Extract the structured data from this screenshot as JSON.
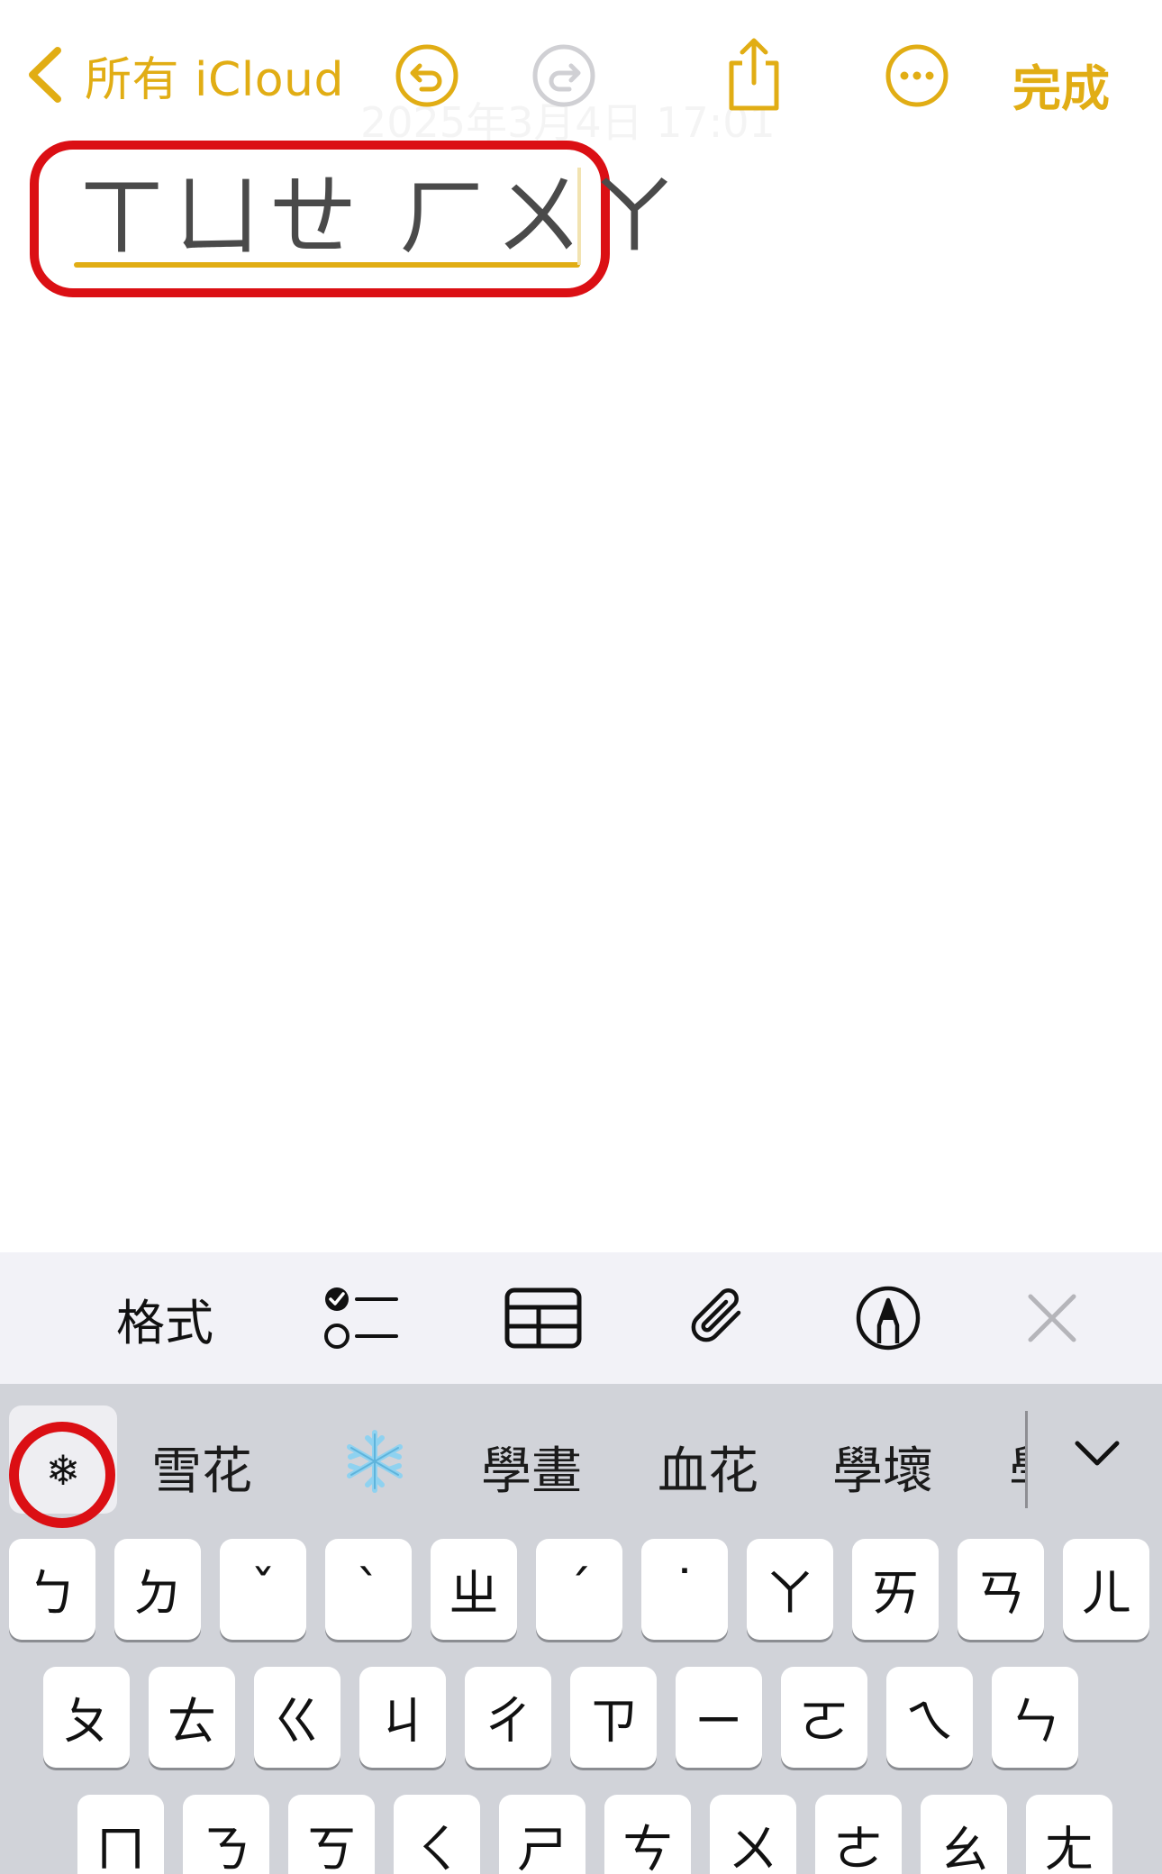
{
  "nav": {
    "back_label": "所有 iCloud",
    "done_label": "完成",
    "note_date": "2025年3月4日 17:01"
  },
  "note": {
    "marked_text": "ㄒㄩㄝ ㄏㄨㄚ"
  },
  "toolbar": {
    "format_label": "格式"
  },
  "keyboard": {
    "first_candidate": "❄",
    "candidates": [
      "雪花",
      "❄️",
      "學畫",
      "血花",
      "學壞",
      "學"
    ],
    "row1": [
      "ㄅ",
      "ㄉ",
      "ˇ",
      "ˋ",
      "ㄓ",
      "ˊ",
      "˙",
      "ㄚ",
      "ㄞ",
      "ㄢ",
      "ㄦ"
    ],
    "row2": [
      "ㄆ",
      "ㄊ",
      "ㄍ",
      "ㄐ",
      "ㄔ",
      "ㄗ",
      "ㄧ",
      "ㄛ",
      "ㄟ",
      "ㄣ"
    ],
    "row3": [
      "ㄇ",
      "ㄋ",
      "ㄎ",
      "ㄑ",
      "ㄕ",
      "ㄘ",
      "ㄨ",
      "ㄜ",
      "ㄠ",
      "ㄤ"
    ]
  },
  "colors": {
    "accent": "#e1ad14",
    "highlight_ring": "#db0f14",
    "toolbar_bg": "#f2f2f7",
    "keyboard_bg": "#d1d3d9"
  }
}
